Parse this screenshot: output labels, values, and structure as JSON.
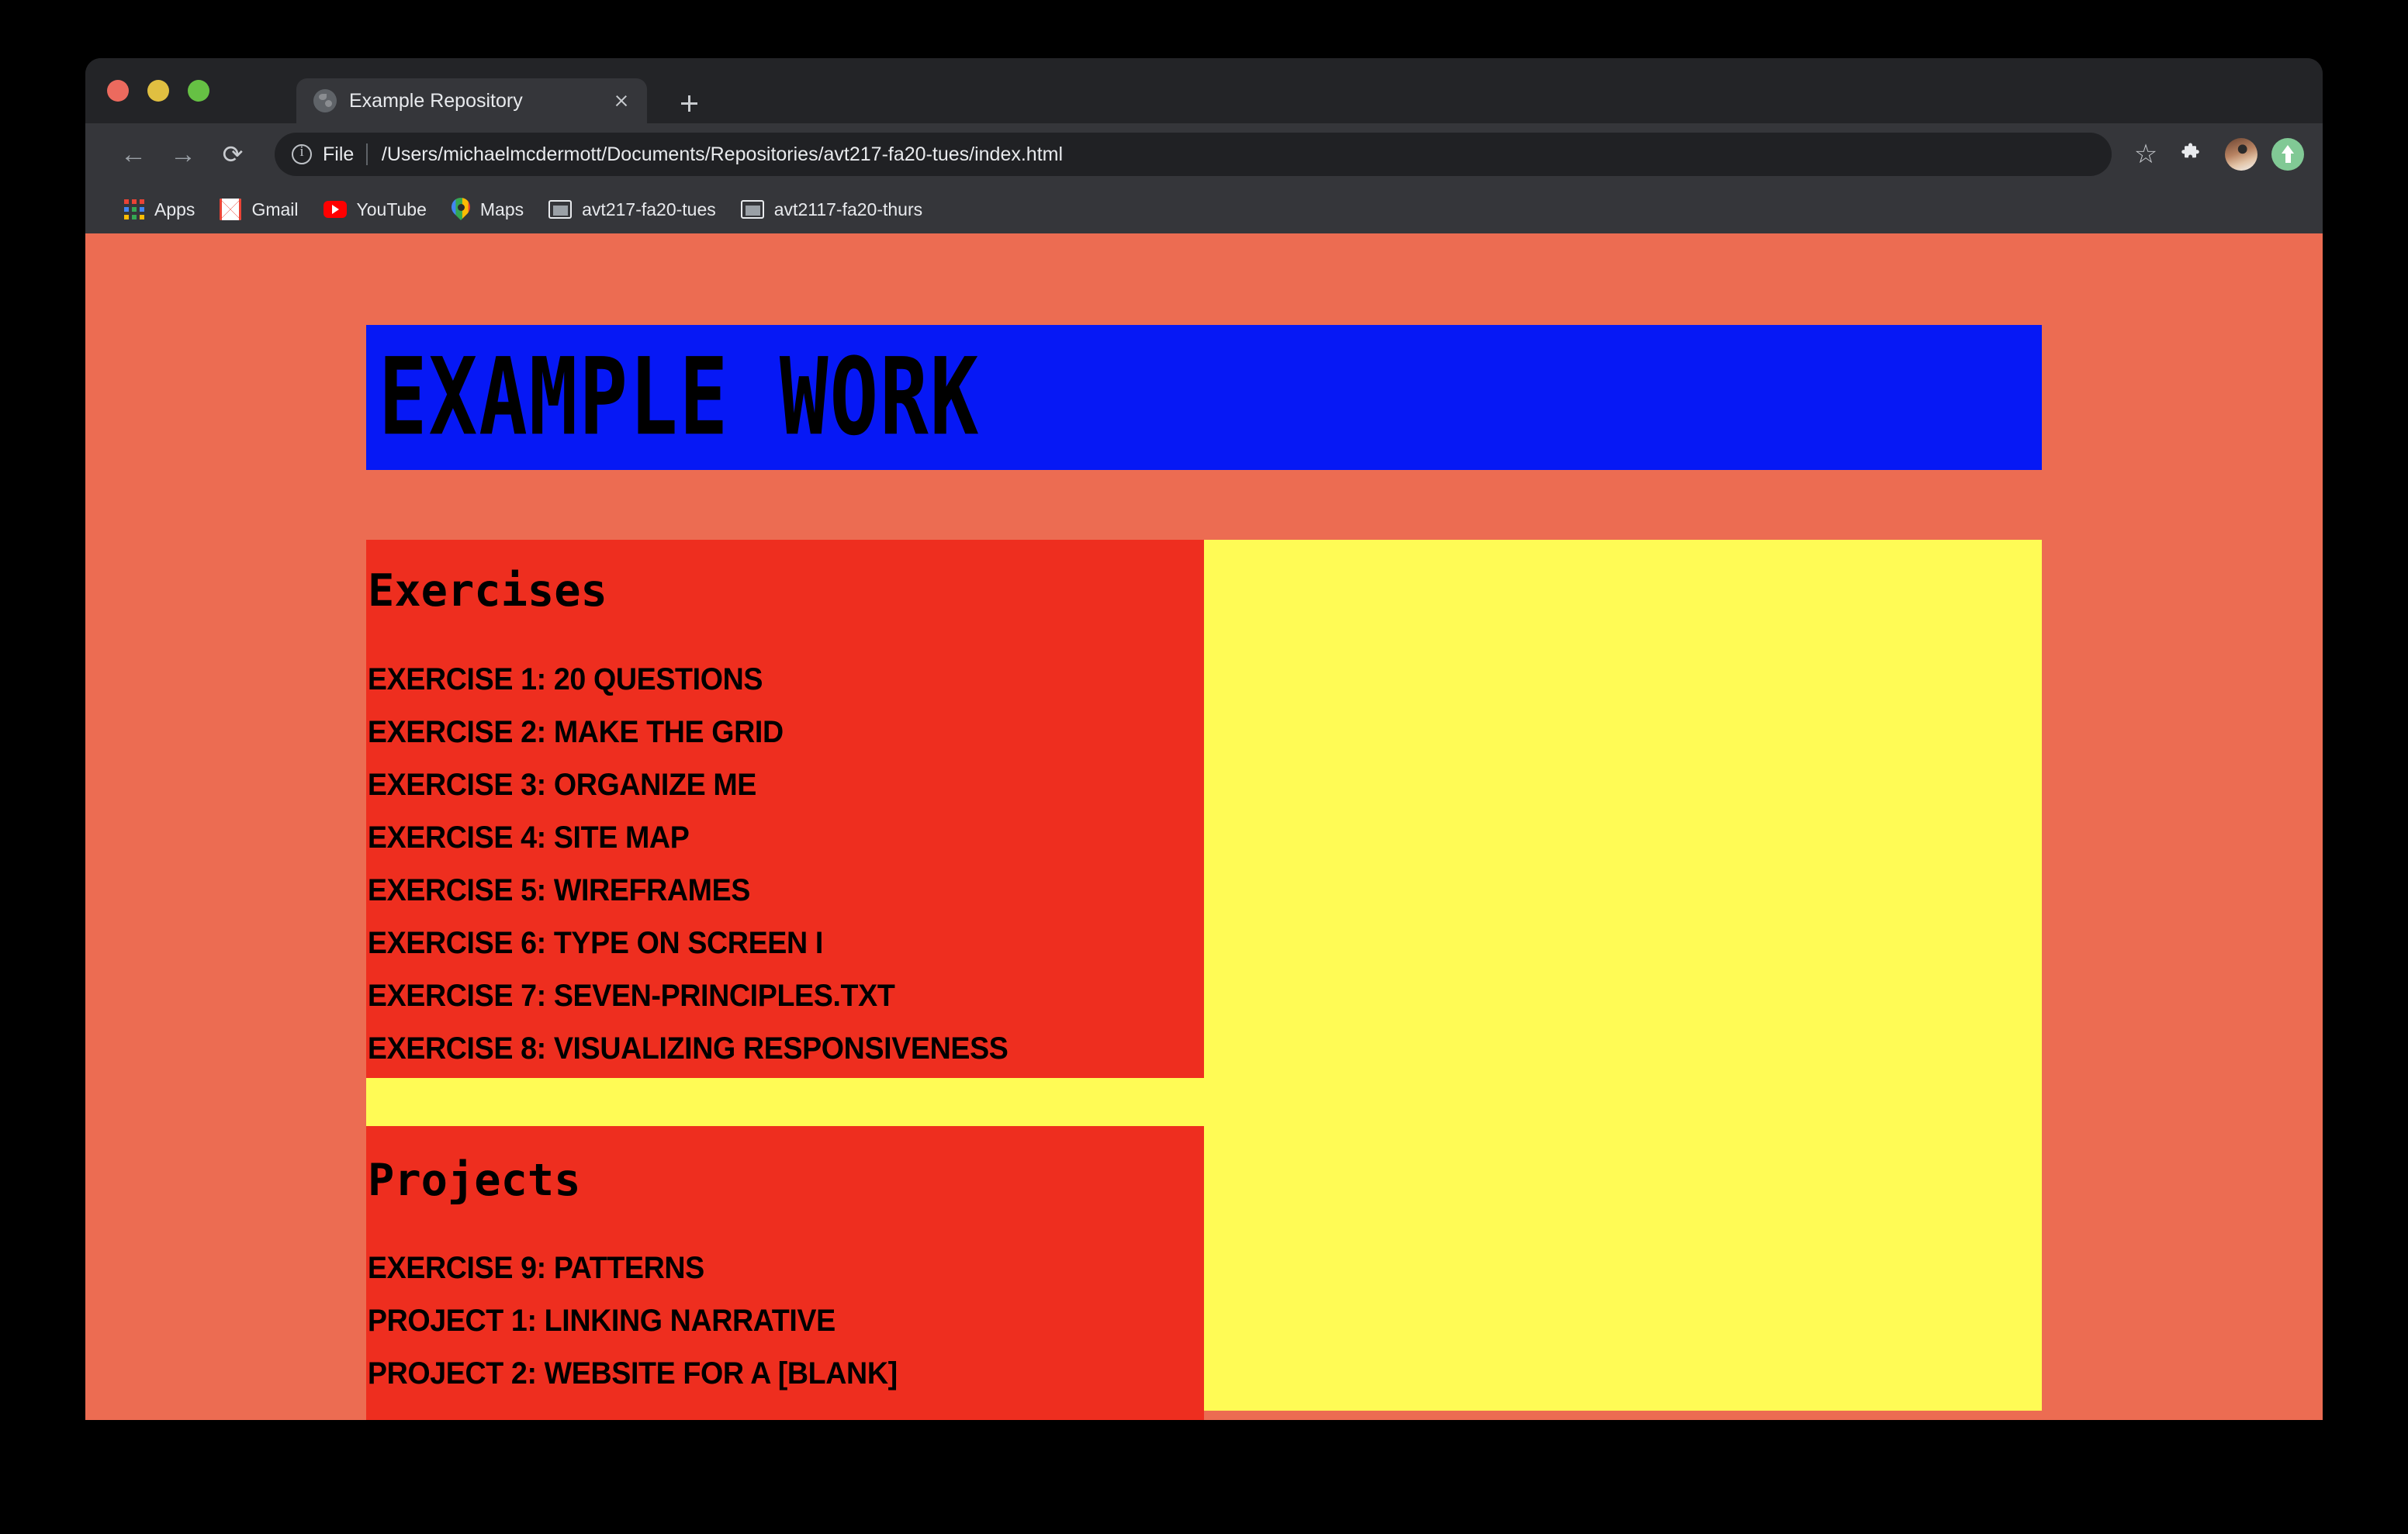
{
  "browser": {
    "traffic_lights": [
      "close",
      "minimize",
      "maximize"
    ],
    "tab": {
      "title": "Example Repository",
      "favicon": "globe-icon",
      "close_label": "×"
    },
    "new_tab_label": "+",
    "toolbar": {
      "back_label": "←",
      "forward_label": "→",
      "reload_label": "⟳",
      "scheme_label": "File",
      "url": "/Users/michaelmcdermott/Documents/Repositories/avt217-fa20-tues/index.html",
      "url_placeholder": "Search Google or type a URL",
      "star_label": "☆",
      "extensions_label": "🧩",
      "avatar_name": "profile-avatar",
      "update_name": "update-available-icon"
    },
    "bookmarks": [
      {
        "label": "Apps",
        "icon": "apps-grid-icon"
      },
      {
        "label": "Gmail",
        "icon": "gmail-icon"
      },
      {
        "label": "YouTube",
        "icon": "youtube-icon"
      },
      {
        "label": "Maps",
        "icon": "maps-pin-icon"
      },
      {
        "label": "avt217-fa20-tues",
        "icon": "folder-icon"
      },
      {
        "label": "avt2117-fa20-thurs",
        "icon": "folder-icon"
      }
    ]
  },
  "page": {
    "title": "EXAMPLE WORK",
    "colors": {
      "background": "#EC6C52",
      "banner": "#0618F5",
      "panel_red": "#EE2E1F",
      "panel_yellow": "#FFFB55",
      "text": "#000000"
    },
    "sections": [
      {
        "heading": "Exercises",
        "items": [
          "EXERCISE 1: 20 QUESTIONS",
          "EXERCISE 2: MAKE THE GRID",
          "EXERCISE 3: ORGANIZE ME",
          "EXERCISE 4: SITE MAP",
          "EXERCISE 5: WIREFRAMES",
          "EXERCISE 6: TYPE ON SCREEN I",
          "EXERCISE 7: SEVEN-PRINCIPLES.TXT",
          "EXERCISE 8: VISUALIZING RESPONSIVENESS"
        ]
      },
      {
        "heading": "Projects",
        "items": [
          "EXERCISE 9: PATTERNS",
          "PROJECT 1: LINKING NARRATIVE",
          "PROJECT 2: WEBSITE FOR A [BLANK]"
        ]
      }
    ]
  }
}
